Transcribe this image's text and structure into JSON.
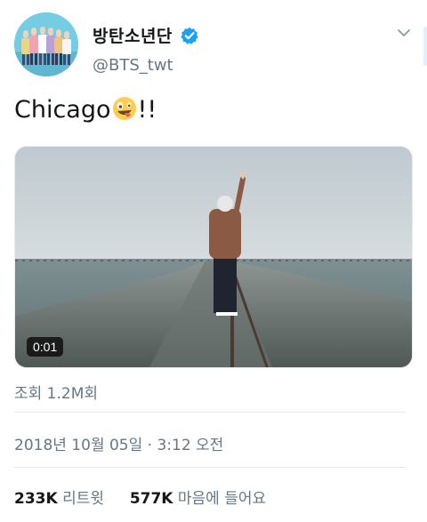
{
  "account": {
    "display_name": "방탄소년단",
    "handle": "@BTS_twt",
    "verified_badge_color": "#1da1f2"
  },
  "tweet": {
    "text_before_emoji": "Chicago",
    "emoji": "zany-face-emoji",
    "text_after_emoji": "!!"
  },
  "media": {
    "type": "video",
    "duration": "0:01"
  },
  "views": {
    "text": "조회 1.2M회"
  },
  "timestamp": {
    "text": "2018년 10월 05일 · 3:12 오전"
  },
  "stats": {
    "retweets_count": "233K",
    "retweets_label": "리트윗",
    "likes_count": "577K",
    "likes_label": "마음에 들어요"
  },
  "icons": {
    "verified": "verified-badge-icon",
    "more": "chevron-down-icon"
  }
}
